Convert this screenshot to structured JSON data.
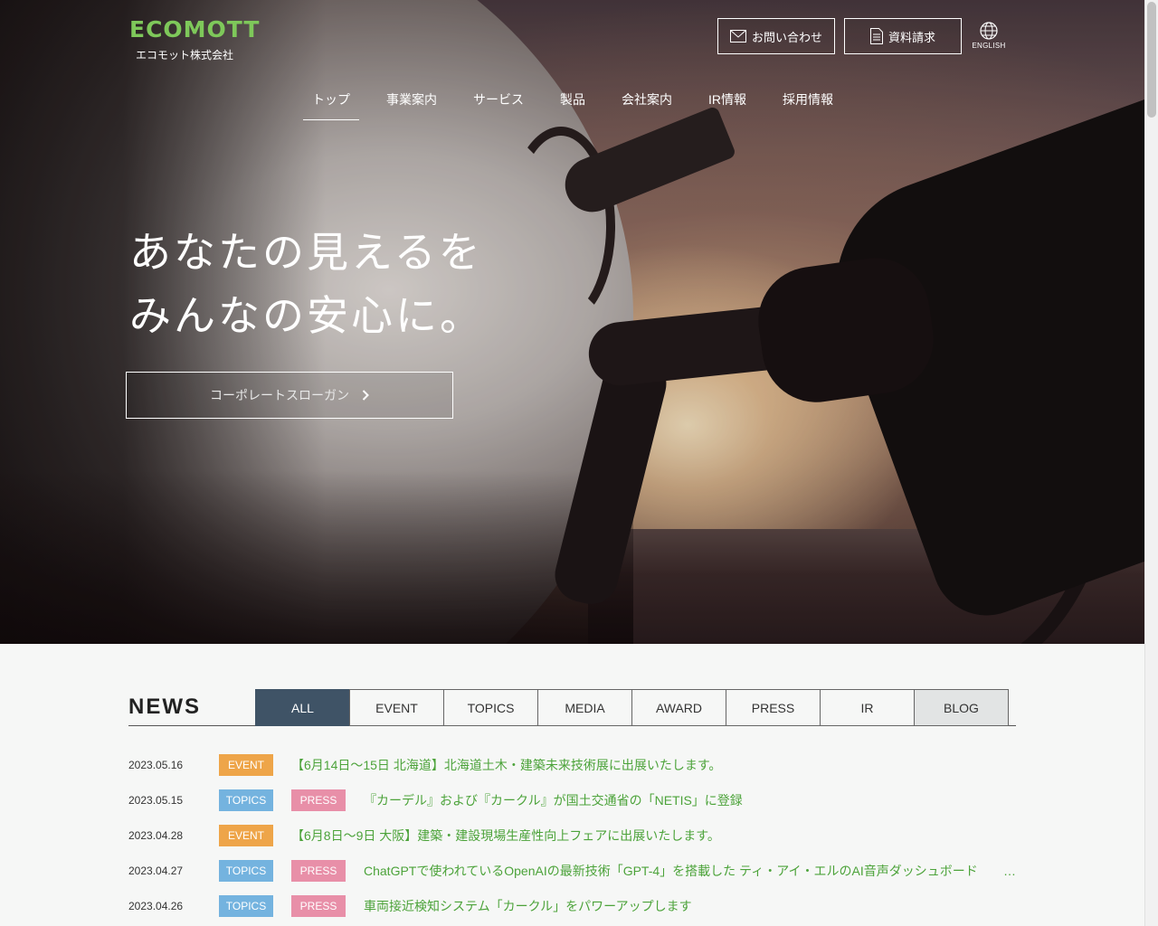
{
  "header": {
    "logo_text": "ECOMOTT",
    "company_name": "エコモット株式会社",
    "contact_label": "お問い合わせ",
    "docs_label": "資料請求",
    "english_label": "ENGLISH"
  },
  "nav": {
    "items": [
      "トップ",
      "事業案内",
      "サービス",
      "製品",
      "会社案内",
      "IR情報",
      "採用情報"
    ],
    "active_index": 0
  },
  "hero": {
    "tagline_line1": "あなたの見えるを",
    "tagline_line2": "みんなの安心に。",
    "slogan_button": "コーポレートスローガン"
  },
  "news": {
    "title": "NEWS",
    "tabs": [
      "ALL",
      "EVENT",
      "TOPICS",
      "MEDIA",
      "AWARD",
      "PRESS",
      "IR",
      "BLOG"
    ],
    "active_tab": "ALL",
    "items": [
      {
        "date": "2023.05.16",
        "tags": [
          "EVENT"
        ],
        "text": "【6月14日～15日 北海道】北海道土木・建築未来技術展に出展いたします。"
      },
      {
        "date": "2023.05.15",
        "tags": [
          "TOPICS",
          "PRESS"
        ],
        "text": "『カーデル』および『カークル』が国土交通省の「NETIS」に登録"
      },
      {
        "date": "2023.04.28",
        "tags": [
          "EVENT"
        ],
        "text": "【6月8日～9日 大阪】建築・建設現場生産性向上フェアに出展いたします。"
      },
      {
        "date": "2023.04.27",
        "tags": [
          "TOPICS",
          "PRESS"
        ],
        "text": "ChatGPTで使われているOpenAIの最新技術「GPT-4」を搭載した ティ・アイ・エルのAI音声ダッシュボード",
        "ellipsis": "…"
      },
      {
        "date": "2023.04.26",
        "tags": [
          "TOPICS",
          "PRESS"
        ],
        "text": "車両接近検知システム「カークル」をパワーアップします"
      }
    ]
  },
  "colors": {
    "brand_green": "#7ec85a",
    "link_green": "#4ca33a",
    "tab_active": "#3f5366",
    "event": "#eea549",
    "topics": "#74b3df",
    "press": "#e88fa8"
  }
}
